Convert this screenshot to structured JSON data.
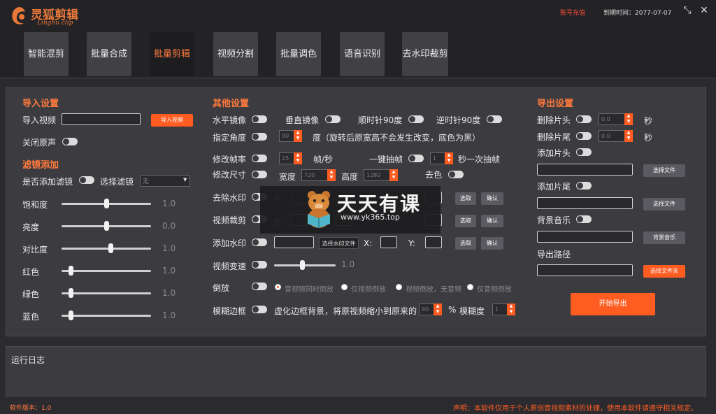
{
  "header": {
    "app_name": "灵狐剪辑",
    "app_name_en": "Linghu clip",
    "recharge_link": "账号充值",
    "expiry": "到期时间：2077-07-07",
    "collapse_icon": "collapse-icon",
    "close_icon": "close-icon",
    "tabs": [
      {
        "label": "智能混剪"
      },
      {
        "label": "批量合成"
      },
      {
        "label": "批量剪辑"
      },
      {
        "label": "视频分割"
      },
      {
        "label": "批量调色"
      },
      {
        "label": "语音识别"
      },
      {
        "label": "去水印裁剪"
      }
    ],
    "active_tab": "批量剪辑",
    "accent_color": "#ff7a3c"
  },
  "import": {
    "title": "导入设置",
    "video_label": "导入视频",
    "import_button": "导入视频",
    "mute_label": "关闭原声"
  },
  "filter": {
    "title": "滤镜添加",
    "add_filter_label": "是否添加滤镜",
    "select_label": "选择滤镜",
    "select_value": "无",
    "sliders": [
      {
        "label": "饱和度",
        "value": "1.0",
        "level": 0.5
      },
      {
        "label": "亮度",
        "value": "0.0",
        "level": 0.5
      },
      {
        "label": "对比度",
        "value": "1.0",
        "level": 0.55
      },
      {
        "label": "红色",
        "value": "1.0",
        "level": 0.1
      },
      {
        "label": "绿色",
        "value": "1.0",
        "level": 0.1
      },
      {
        "label": "蓝色",
        "value": "1.0",
        "level": 0.1
      }
    ]
  },
  "other": {
    "title": "其他设置",
    "hflip": "水平镜像",
    "vflip": "垂直镜像",
    "cw90": "顺时针90度",
    "ccw90": "逆时针90度",
    "angle_label": "指定角度",
    "angle_value": "90",
    "angle_unit": "度（旋转后原宽高不会发生改变，底色为黑）",
    "fps_label": "修改帧率",
    "fps_value": "25",
    "fps_unit": "帧/秒",
    "drop_frame_label": "一键抽帧",
    "drop_frame_value": "1",
    "drop_frame_unit": "秒一次抽帧",
    "size_label": "修改尺寸",
    "width_label": "宽度",
    "width_value": "720",
    "height_label": "高度",
    "height_value": "1280",
    "decolor_label": "去色",
    "remove_wm_label": "去除水印",
    "x_label": "X:",
    "crop_label": "视频裁剪",
    "crop_left": "左:",
    "pick_button": "选取",
    "confirm_button": "确认",
    "add_wm_label": "添加水印",
    "select_wm_button": "选择水印文件",
    "y_label": "Y:",
    "speed_label": "视频变速",
    "speed_value": "1.0",
    "speed_level": 0.45,
    "reverse_label": "倒放",
    "reverse_options": [
      "音视频同时倒放",
      "仅视频倒放",
      "视频倒放，无音频",
      "仅音频倒放"
    ],
    "blur_label": "模糊边框",
    "blur_desc": "虚化边框背景，将原视频缩小到原来的",
    "blur_pct": "90",
    "blur_pct_unit": "%",
    "blur_degree_label": "模糊度",
    "blur_degree": "1"
  },
  "export": {
    "title": "导出设置",
    "trim_head_label": "删除片头",
    "trim_head_value": "0.0",
    "trim_tail_label": "删除片尾",
    "trim_tail_value": "0.0",
    "sec_unit": "秒",
    "add_head_label": "添加片头",
    "add_tail_label": "添加片尾",
    "choose_file_button": "选择文件",
    "bgm_label": "背景音乐",
    "bgm_button": "背景音乐",
    "path_label": "导出路径",
    "choose_folder_button": "选择文件夹",
    "start_button": "开始导出"
  },
  "log": {
    "title": "运行日志"
  },
  "footer": {
    "version": "软件版本：1.0",
    "disclaimer": "声明：本软件仅用于个人原创音视频素材的处理，使用本软件请遵守相关规定。"
  },
  "watermark": {
    "title": "天天有课",
    "url": "www.yk365.top"
  }
}
